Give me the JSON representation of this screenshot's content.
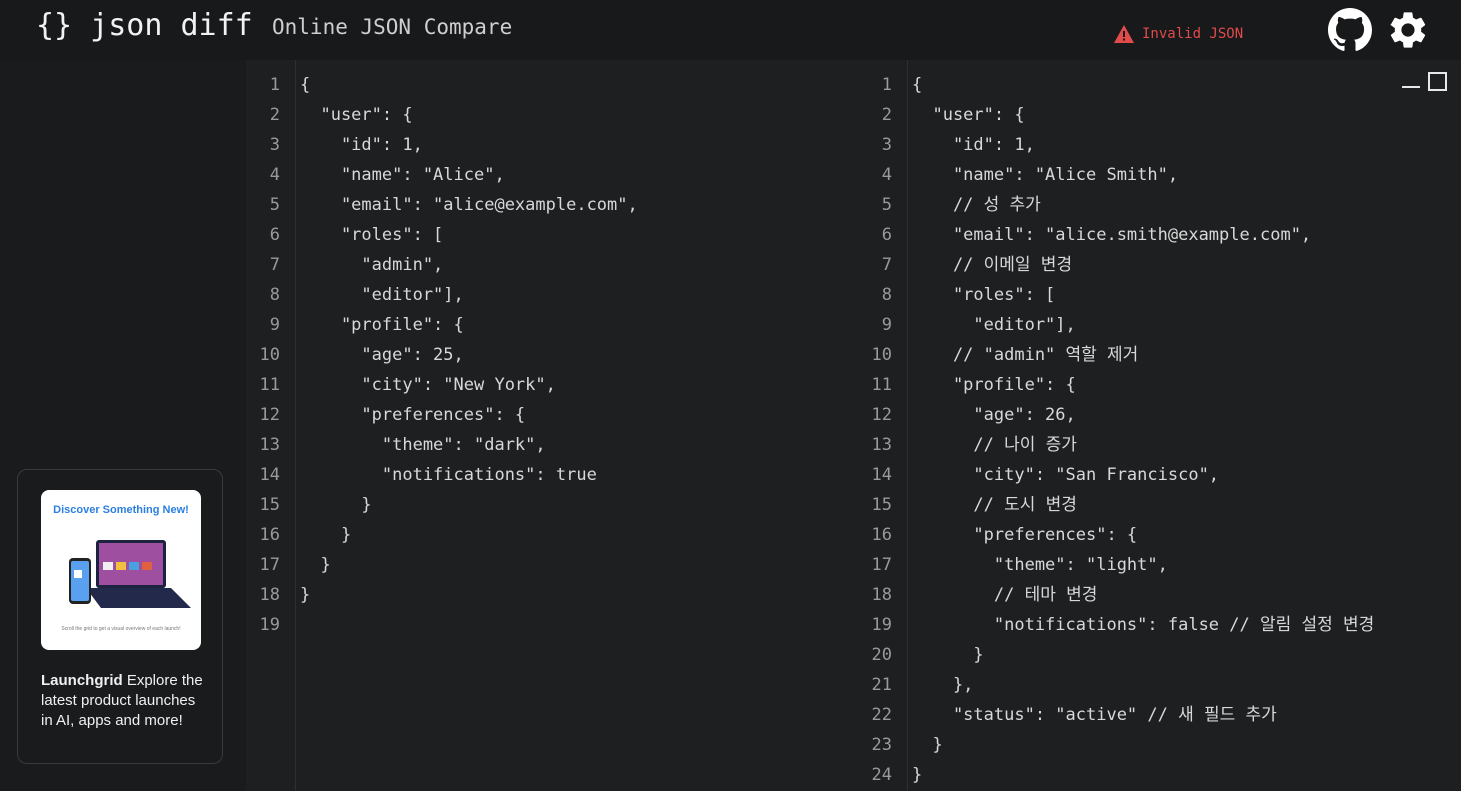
{
  "header": {
    "logo": "{} json diff",
    "subtitle": "Online JSON Compare",
    "error_text": "Invalid JSON",
    "github_icon": "github-icon",
    "settings_icon": "gear-icon"
  },
  "sidebar": {
    "ad": {
      "image_headline": "Discover Something New!",
      "image_caption": "Scroll the grid to get a visual overview of each launch!",
      "brand": "Launchgrid",
      "description": " Explore the latest product launches in AI, apps and more!"
    }
  },
  "left_editor": {
    "line_numbers": [
      "1",
      "2",
      "3",
      "4",
      "5",
      "6",
      "7",
      "8",
      "9",
      "10",
      "11",
      "12",
      "13",
      "14",
      "15",
      "16",
      "17",
      "18",
      "19"
    ],
    "lines": [
      "{",
      "  \"user\": {",
      "    \"id\": 1,",
      "    \"name\": \"Alice\",",
      "    \"email\": \"alice@example.com\",",
      "    \"roles\": [",
      "      \"admin\",",
      "      \"editor\"],",
      "    \"profile\": {",
      "      \"age\": 25,",
      "      \"city\": \"New York\",",
      "      \"preferences\": {",
      "        \"theme\": \"dark\",",
      "        \"notifications\": true",
      "      }",
      "    }",
      "  }",
      "}",
      ""
    ]
  },
  "right_editor": {
    "line_numbers": [
      "1",
      "2",
      "3",
      "4",
      "5",
      "6",
      "7",
      "8",
      "9",
      "10",
      "11",
      "12",
      "13",
      "14",
      "15",
      "16",
      "17",
      "18",
      "19",
      "20",
      "21",
      "22",
      "23",
      "24"
    ],
    "lines": [
      "{",
      "  \"user\": {",
      "    \"id\": 1,",
      "    \"name\": \"Alice Smith\",",
      "    // 성 추가",
      "    \"email\": \"alice.smith@example.com\",",
      "    // 이메일 변경",
      "    \"roles\": [",
      "      \"editor\"],",
      "    // \"admin\" 역할 제거",
      "    \"profile\": {",
      "      \"age\": 26,",
      "      // 나이 증가",
      "      \"city\": \"San Francisco\",",
      "      // 도시 변경",
      "      \"preferences\": {",
      "        \"theme\": \"light\",",
      "        // 테마 변경",
      "        \"notifications\": false // 알림 설정 변경",
      "      }",
      "    },",
      "    \"status\": \"active\" // 새 필드 추가",
      "  }",
      "}"
    ]
  }
}
